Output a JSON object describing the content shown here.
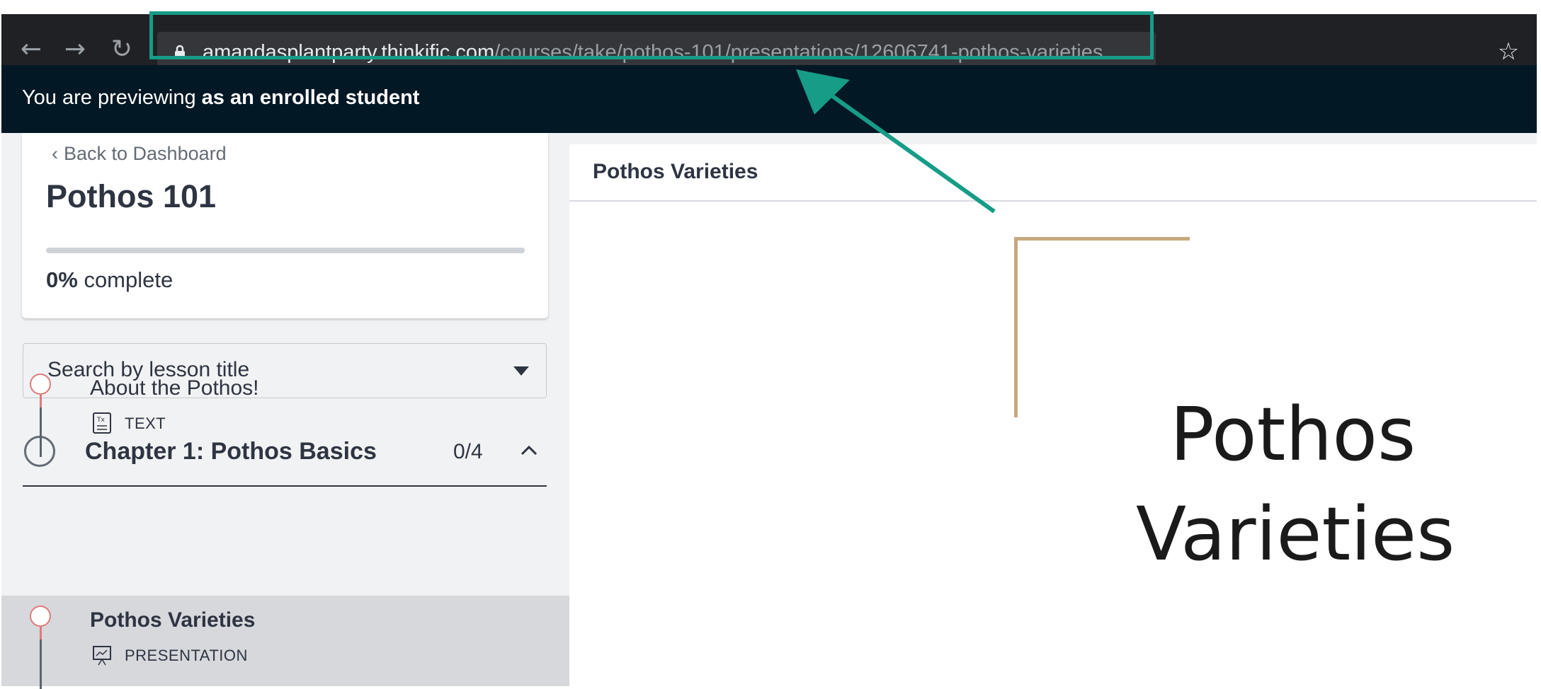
{
  "browser": {
    "back_icon": "arrow-left-icon",
    "forward_icon": "arrow-right-icon",
    "reload_icon": "reload-icon",
    "lock_icon": "lock-icon",
    "bookmark_icon": "star-icon",
    "url_host": "amandasplantparty.thinkific.com",
    "url_path": "/courses/take/pothos-101/presentations/12606741-pothos-varieties",
    "highlight_color": "#169c87"
  },
  "banner": {
    "prefix": "You are previewing",
    "emphasis": "as an enrolled student"
  },
  "sidebar": {
    "back_label": "Back to Dashboard",
    "course_title": "Pothos 101",
    "progress_percent": 0,
    "progress_value": "0%",
    "progress_suffix": "complete",
    "search_placeholder": "Search by lesson title",
    "chapter": {
      "title": "Chapter 1: Pothos Basics",
      "count": "0/4"
    },
    "lessons": [
      {
        "title": "About the Pothos!",
        "type": "TEXT",
        "icon": "text-lesson-icon",
        "active": false
      },
      {
        "title": "Pothos Varieties",
        "type": "PRESENTATION",
        "icon": "presentation-icon",
        "active": true
      }
    ]
  },
  "content": {
    "header_title": "Pothos Varieties",
    "slide_line1": "Pothos",
    "slide_line2": "Varieties",
    "accent_color": "#c7a97d"
  }
}
